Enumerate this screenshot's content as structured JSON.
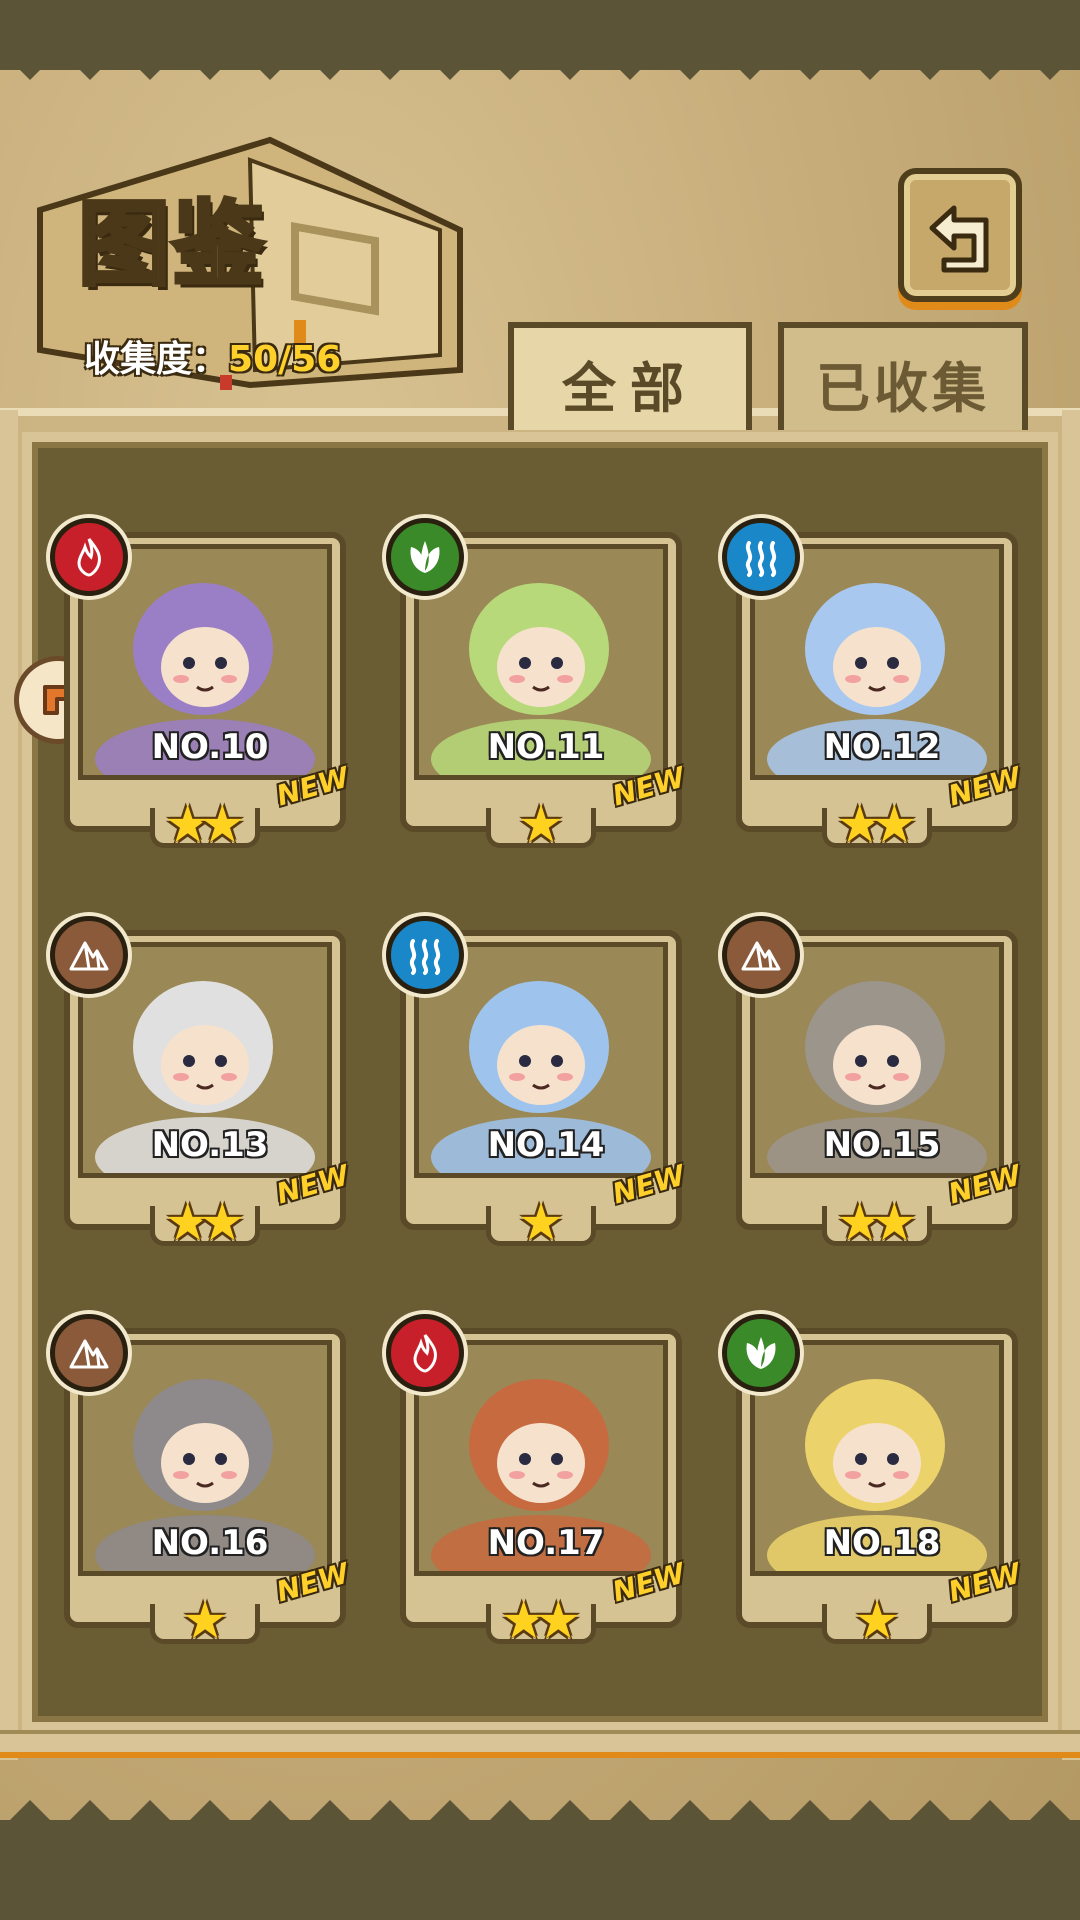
{
  "header": {
    "title": "图鉴",
    "collection_label": "收集度：",
    "collection_value": "50/56"
  },
  "tabs": [
    {
      "label": "全部",
      "active": true
    },
    {
      "label": "已收集",
      "active": false
    }
  ],
  "cards": [
    {
      "number": "NO.10",
      "badge": "NEW",
      "stars": 2,
      "element": "fire-icon",
      "art_color": "#9b7fc6"
    },
    {
      "number": "NO.11",
      "badge": "NEW",
      "stars": 1,
      "element": "leaf-icon",
      "art_color": "#b7d97a"
    },
    {
      "number": "NO.12",
      "badge": "NEW",
      "stars": 2,
      "element": "water-icon",
      "art_color": "#a9c8ef"
    },
    {
      "number": "NO.13",
      "badge": "NEW",
      "stars": 2,
      "element": "earth-icon",
      "art_color": "#e0e0e0"
    },
    {
      "number": "NO.14",
      "badge": "NEW",
      "stars": 1,
      "element": "water-icon",
      "art_color": "#9ec4ee"
    },
    {
      "number": "NO.15",
      "badge": "NEW",
      "stars": 2,
      "element": "earth-icon",
      "art_color": "#9c958c"
    },
    {
      "number": "NO.16",
      "badge": "NEW",
      "stars": 1,
      "element": "earth-icon",
      "art_color": "#8e8a8c"
    },
    {
      "number": "NO.17",
      "badge": "NEW",
      "stars": 2,
      "element": "fire-icon",
      "art_color": "#c86a40"
    },
    {
      "number": "NO.18",
      "badge": "NEW",
      "stars": 1,
      "element": "leaf-icon",
      "art_color": "#ecd26a"
    }
  ],
  "icons": {
    "back": "back-arrow-icon",
    "side": "scroll-arrow-icon"
  },
  "colors": {
    "gold": "#ffcf2a",
    "parchment": "#c8ae7b",
    "frame_dark": "#5a4a28"
  }
}
